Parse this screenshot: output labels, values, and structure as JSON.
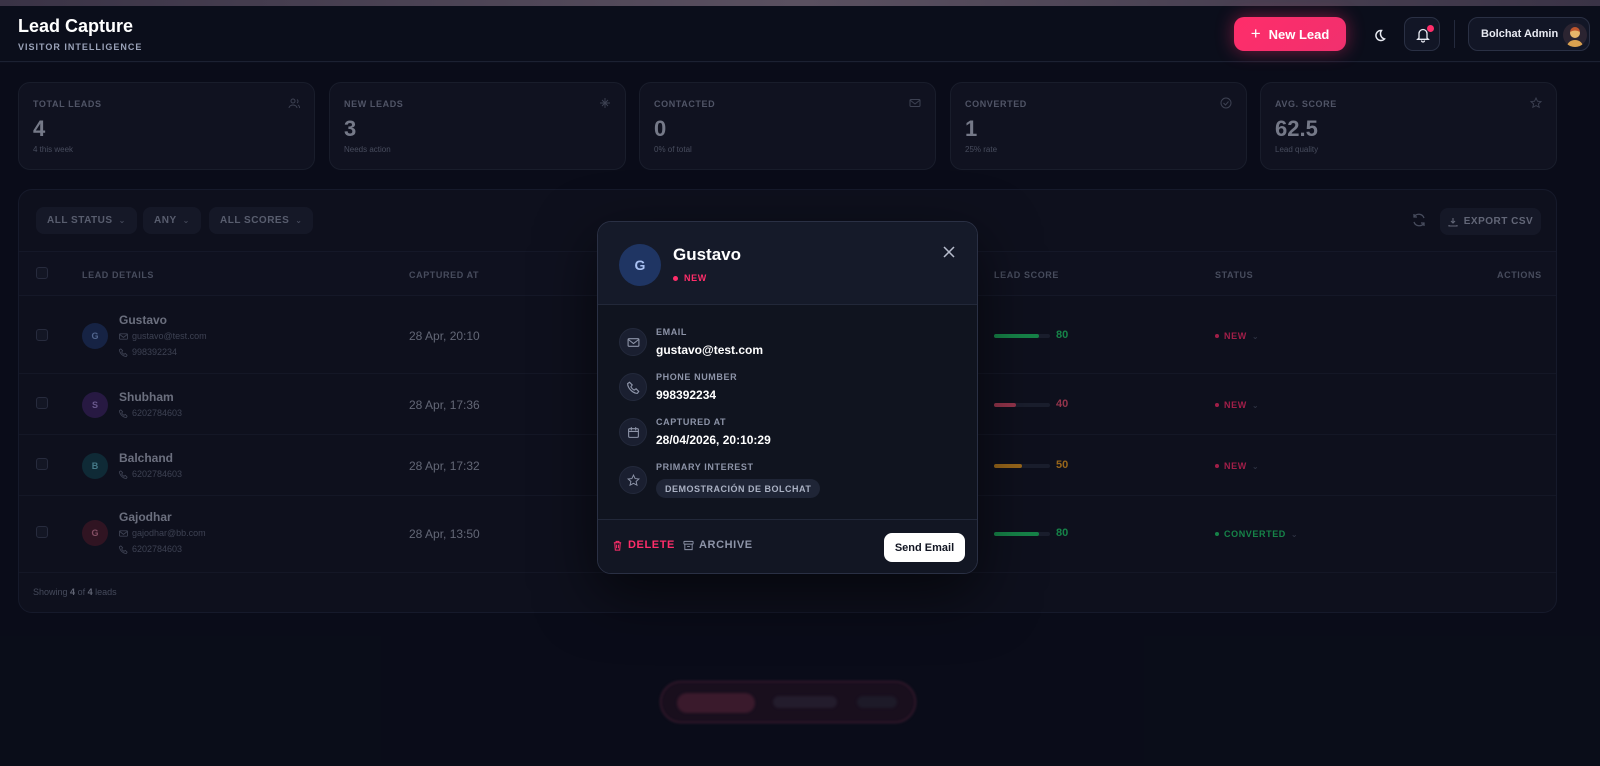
{
  "header": {
    "title": "Lead Capture",
    "subtitle": "VISITOR INTELLIGENCE",
    "new_lead_label": "New Lead",
    "user_name": "Bolchat Admin"
  },
  "stats": [
    {
      "label": "TOTAL LEADS",
      "value": "4",
      "note": "4 this week",
      "icon": "users-icon"
    },
    {
      "label": "NEW LEADS",
      "value": "3",
      "note": "Needs action",
      "icon": "sparkle-icon"
    },
    {
      "label": "CONTACTED",
      "value": "0",
      "note": "0% of total",
      "icon": "mail-icon"
    },
    {
      "label": "CONVERTED",
      "value": "1",
      "note": "25% rate",
      "icon": "check-circle-icon"
    },
    {
      "label": "AVG. SCORE",
      "value": "62.5",
      "note": "Lead quality",
      "icon": "star-icon"
    }
  ],
  "filters": {
    "status": "ALL STATUS",
    "any": "ANY",
    "scores": "ALL SCORES",
    "export_label": "EXPORT CSV"
  },
  "table": {
    "columns": [
      "LEAD DETAILS",
      "CAPTURED AT",
      "LEAD SCORE",
      "STATUS",
      "ACTIONS"
    ],
    "rows": [
      {
        "initial": "G",
        "name": "Gustavo",
        "email": "gustavo@test.com",
        "phone": "998392234",
        "captured": "28 Apr, 20:10",
        "score": 80,
        "score_label": "80",
        "status": "NEW",
        "avatar_color": "#1f3563",
        "score_color": "#1fcf6a"
      },
      {
        "initial": "S",
        "name": "Shubham",
        "email": "",
        "phone": "6202784603",
        "captured": "28 Apr, 17:36",
        "score": 40,
        "score_label": "40",
        "status": "NEW",
        "avatar_color": "#3a2560",
        "score_color": "#e8506e"
      },
      {
        "initial": "B",
        "name": "Balchand",
        "email": "",
        "phone": "6202784603",
        "captured": "28 Apr, 17:32",
        "score": 50,
        "score_label": "50",
        "status": "NEW",
        "avatar_color": "#14404c",
        "score_color": "#f0a020"
      },
      {
        "initial": "G",
        "name": "Gajodhar",
        "email": "gajodhar@bb.com",
        "phone": "6202784603",
        "captured": "28 Apr, 13:50",
        "score": 80,
        "score_label": "80",
        "status": "CONVERTED",
        "avatar_color": "#4a1c2c",
        "score_color": "#1fcf6a"
      }
    ],
    "showing_prefix": "Showing",
    "showing_count": "4",
    "showing_of": "of",
    "showing_total": "4",
    "showing_suffix": "leads"
  },
  "modal": {
    "initial": "G",
    "name": "Gustavo",
    "status": "NEW",
    "email_label": "EMAIL",
    "email": "gustavo@test.com",
    "phone_label": "PHONE NUMBER",
    "phone": "998392234",
    "captured_label": "CAPTURED AT",
    "captured": "28/04/2026, 20:10:29",
    "interest_label": "PRIMARY INTEREST",
    "interest": "DEMOSTRACIÓN DE BOLCHAT",
    "delete_label": "DELETE",
    "archive_label": "ARCHIVE",
    "send_label": "Send Email"
  },
  "colors": {
    "accent": "#ff2d6a",
    "new_status": "#ff2d6a",
    "converted_status": "#1fcf6a"
  }
}
